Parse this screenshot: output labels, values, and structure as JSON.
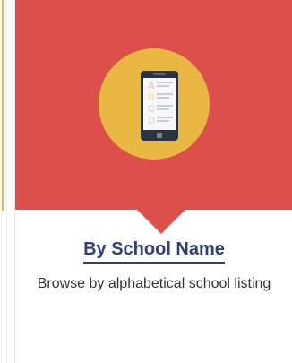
{
  "card": {
    "title": "By School Name",
    "description": "Browse by alphabetical school listing",
    "icon": "phone-list-icon",
    "icon_letters": [
      "A",
      "B",
      "C",
      "D"
    ],
    "colors": {
      "hero": "#dc4f4b",
      "circle": "#e9b843",
      "title": "#2f3f7d",
      "letter_a": "#f2c9c7",
      "letter_b": "#f2e4b8",
      "letter_c": "#cbe0f0",
      "letter_d": "#dcdcdc"
    }
  }
}
